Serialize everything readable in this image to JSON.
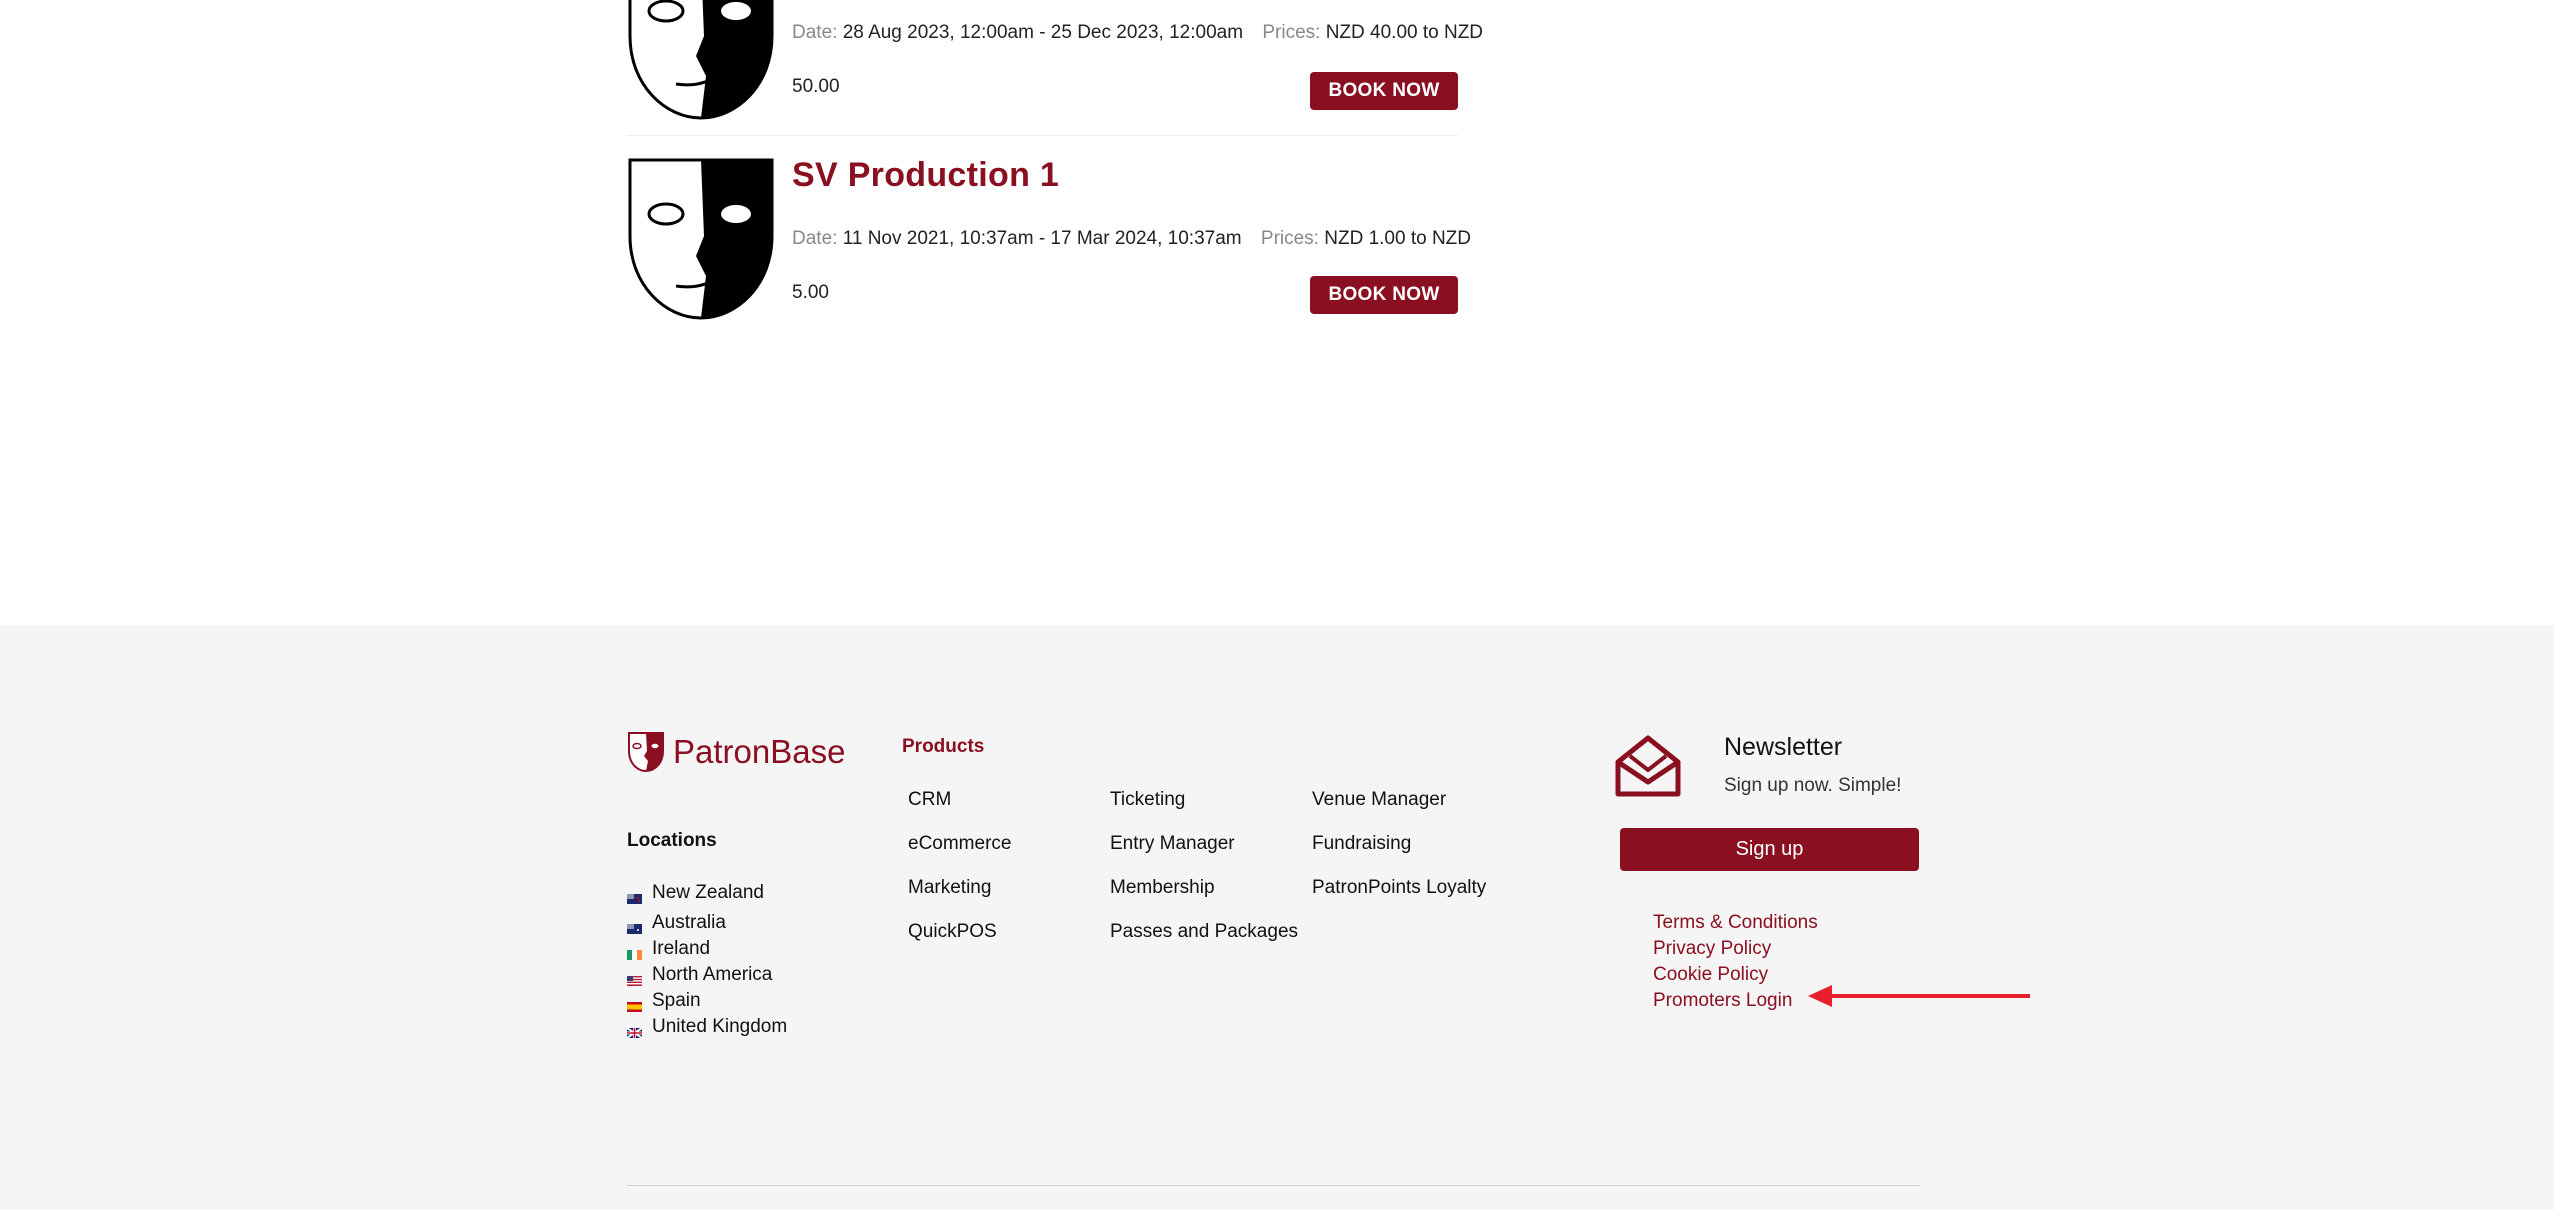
{
  "events": [
    {
      "date_label": "Date:",
      "date_value": "28 Aug 2023, 12:00am - 25 Dec 2023, 12:00am",
      "prices_label": "Prices:",
      "prices_value": "NZD 40.00 to NZD",
      "prices_cont": "50.00",
      "book_label": "BOOK NOW"
    },
    {
      "title": "SV Production 1",
      "date_label": "Date:",
      "date_value": "11 Nov 2021, 10:37am - 17 Mar 2024, 10:37am",
      "prices_label": "Prices:",
      "prices_value": "NZD 1.00 to NZD",
      "prices_cont": "5.00",
      "book_label": "BOOK NOW"
    }
  ],
  "footer": {
    "brand": "PatronBase",
    "locations_title": "Locations",
    "locations": [
      "New Zealand",
      "Australia",
      "Ireland",
      "North America",
      "Spain",
      "United Kingdom"
    ],
    "products_title": "Products",
    "products_col1": [
      "CRM",
      "eCommerce",
      "Marketing",
      "QuickPOS"
    ],
    "products_col2": [
      "Ticketing",
      "Entry Manager",
      "Membership",
      "Passes and Packages"
    ],
    "products_col3": [
      "Venue Manager",
      "Fundraising",
      "PatronPoints Loyalty"
    ],
    "newsletter_title": "Newsletter",
    "newsletter_sub": "Sign up now. Simple!",
    "signup_label": "Sign up",
    "legal": [
      "Terms & Conditions",
      "Privacy Policy",
      "Cookie Policy",
      "Promoters Login"
    ]
  },
  "colors": {
    "brand": "#8a1021",
    "footer_bg": "#f5f5f5",
    "annotation_arrow": "#e8202e"
  }
}
